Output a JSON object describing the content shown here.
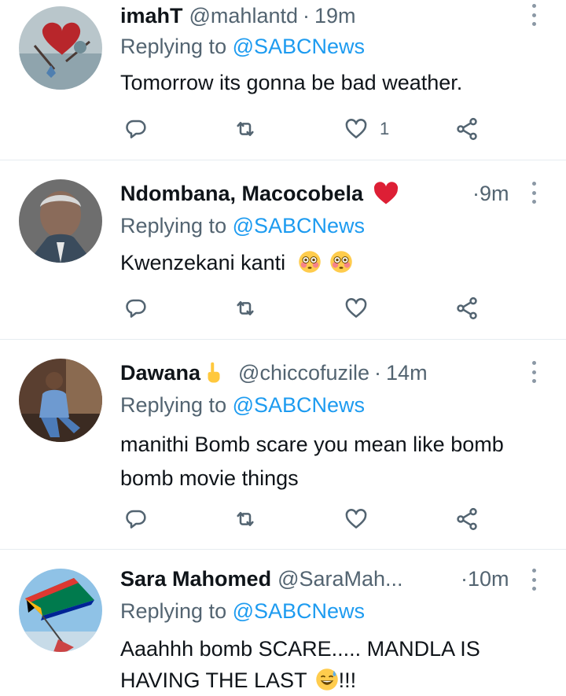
{
  "tweets": [
    {
      "name": "imahT",
      "handle": "@mahlantd",
      "dot": "·",
      "time": "19m",
      "replying_prefix": "Replying to",
      "replying_to": "@SABCNews",
      "text_lines": [
        "Tomorrow its gonna be bad weather."
      ],
      "like_count": "1"
    },
    {
      "name": "Ndombana, Macocobela",
      "name_emoji": "red-heart",
      "handle": "",
      "dot": "·",
      "time": "9m",
      "replying_prefix": "Replying to",
      "replying_to": "@SABCNews",
      "text_lines": [
        "Kwenzekani kanti"
      ],
      "text_emoji": [
        "flushed-face",
        "flushed-face"
      ],
      "like_count": ""
    },
    {
      "name": "Dawana",
      "name_emoji": "pointing-up-hand",
      "handle": "@chiccofuzile",
      "dot": "·",
      "time": "14m",
      "replying_prefix": "Replying to",
      "replying_to": "@SABCNews",
      "text_lines": [
        "manithi Bomb scare you mean like bomb",
        "bomb movie things"
      ],
      "like_count": ""
    },
    {
      "name": "Sara Mahomed",
      "handle": "@SaraMah...",
      "dot": "·",
      "time": "10m",
      "replying_prefix": "Replying to",
      "replying_to": "@SABCNews",
      "text_lines": [
        "Aaahhh bomb SCARE..... MANDLA IS",
        "HAVING THE LAST"
      ],
      "text_end": "!!!",
      "text_emoji": [
        "sweat-smile-face"
      ],
      "like_count": ""
    }
  ],
  "icons": {
    "reply": "reply-icon",
    "retweet": "retweet-icon",
    "like": "like-icon",
    "share": "share-icon",
    "more": "more-options-icon"
  },
  "colors": {
    "text": "#0f1419",
    "secondary": "#536471",
    "link": "#1d9bf0",
    "divider": "#e6ecf0"
  }
}
